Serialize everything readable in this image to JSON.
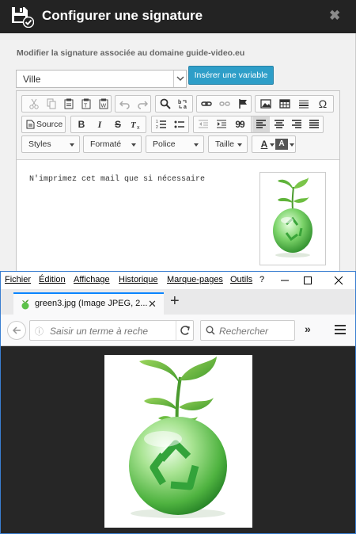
{
  "dialog": {
    "title": "Configurer une signature",
    "close_glyph": "✖",
    "subtitle": "Modifier la signature associée au domaine guide-video.eu",
    "variable_select": {
      "value": "Ville"
    },
    "insert_variable_label": "Insérer une variable",
    "toolbar": {
      "source_label": "Source",
      "styles_label": "Styles",
      "format_label": "Formaté",
      "font_label": "Police",
      "size_label": "Taille",
      "bold_glyph": "B",
      "italic_glyph": "I",
      "strike_glyph": "S",
      "quote_glyph": "99",
      "special_char_glyph": "Ω",
      "text_color_glyph": "A",
      "bg_color_glyph": "A"
    },
    "signature_text": "N'imprimez cet mail que si nécessaire",
    "accent_color": "#2e9ec8"
  },
  "browser": {
    "menu": [
      "Fichier",
      "Édition",
      "Affichage",
      "Historique",
      "Marque-pages",
      "Outils",
      "?"
    ],
    "tab_title": "green3.jpg (Image JPEG, 2...",
    "new_tab_glyph": "+",
    "url_placeholder": "Saisir un terme à reche",
    "search_placeholder": "Rechercher",
    "overflow_glyph": "»",
    "tab_accent": "#0a84ff"
  }
}
